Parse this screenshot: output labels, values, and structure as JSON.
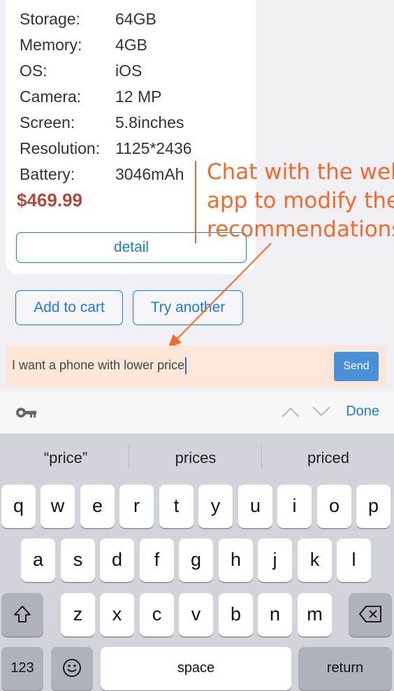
{
  "specs": [
    {
      "label": "Storage:",
      "value": "64GB"
    },
    {
      "label": "Memory:",
      "value": "4GB"
    },
    {
      "label": "OS:",
      "value": "iOS"
    },
    {
      "label": "Camera:",
      "value": "12 MP"
    },
    {
      "label": "Screen:",
      "value": "5.8inches"
    },
    {
      "label": "Resolution:",
      "value": "1125*2436"
    },
    {
      "label": "Battery:",
      "value": "3046mAh"
    }
  ],
  "price": "$469.99",
  "detail_label": "detail",
  "add_to_cart_label": "Add to cart",
  "try_another_label": "Try another",
  "annotation": {
    "lines": [
      "Chat with the web",
      "app to modify the",
      "recommendations"
    ],
    "color": "#f26a2c"
  },
  "chat": {
    "input_value": "I want a phone with lower price",
    "send_label": "Send"
  },
  "accessory": {
    "done_label": "Done",
    "icons": [
      "key-icon",
      "chevron-up-icon",
      "chevron-down-icon"
    ]
  },
  "keyboard": {
    "suggestions": [
      "“price”",
      "prices",
      "priced"
    ],
    "row1": [
      "q",
      "w",
      "e",
      "r",
      "t",
      "y",
      "u",
      "i",
      "o",
      "p"
    ],
    "row2": [
      "a",
      "s",
      "d",
      "f",
      "g",
      "h",
      "j",
      "k",
      "l"
    ],
    "row3": [
      "z",
      "x",
      "c",
      "v",
      "b",
      "n",
      "m"
    ],
    "numbers_label": "123",
    "space_label": "space",
    "return_label": "return"
  },
  "colors": {
    "accent": "#1d7bd8",
    "price": "#b5473f",
    "chat_bg": "#fde5d8",
    "send_bg": "#4a90d9"
  }
}
